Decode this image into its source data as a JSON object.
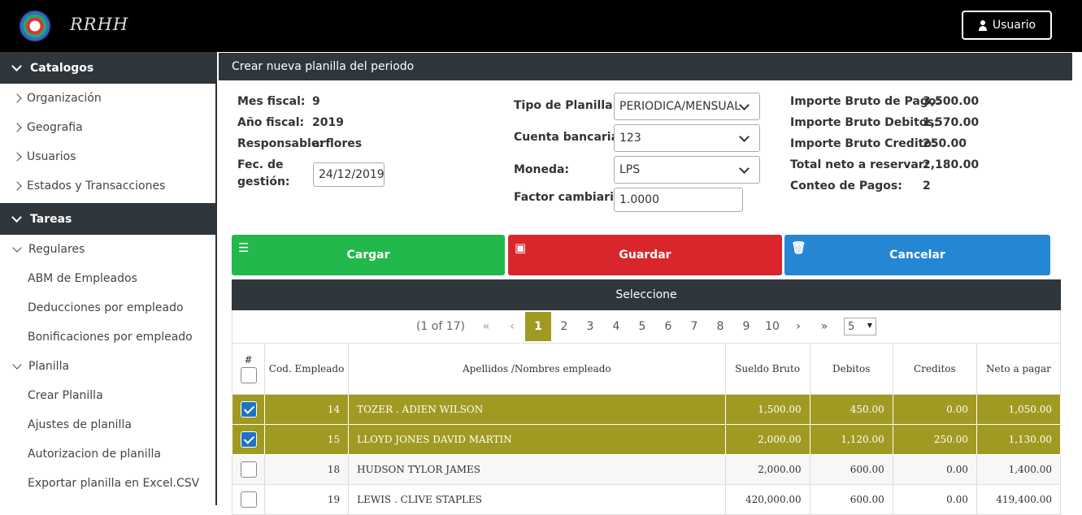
{
  "header": {
    "brand": "RRHH",
    "user_button": "Usuario"
  },
  "sidebar": {
    "catalogos": {
      "title": "Catalogos",
      "items": [
        "Organización",
        "Geografia",
        "Usuarios",
        "Estados y Transacciones"
      ]
    },
    "tareas": {
      "title": "Tareas",
      "groups": [
        {
          "label": "Regulares",
          "items": [
            "ABM de Empleados",
            "Deducciones por empleado",
            "Bonificaciones por empleado"
          ]
        },
        {
          "label": "Planilla",
          "items": [
            "Crear Planilla",
            "Ajustes de planilla",
            "Autorizacion de planilla",
            "Exportar planilla en Excel.CSV"
          ]
        }
      ]
    }
  },
  "panel": {
    "title": "Crear nueva planilla del periodo",
    "left": {
      "mes_fiscal_label": "Mes fiscal:",
      "mes_fiscal": "9",
      "anio_fiscal_label": "Año fiscal:",
      "anio_fiscal": "2019",
      "responsable_label": "Responsable:",
      "responsable": "arflores",
      "fecha_label_1": "Fec. de",
      "fecha_label_2": "gestión:",
      "fecha": "24/12/2019"
    },
    "middle": {
      "tipo_label": "Tipo de Planilla:",
      "tipo": "PERIODICA/MENSUAL",
      "cuenta_label": "Cuenta bancaria:",
      "cuenta": "123",
      "moneda_label": "Moneda:",
      "moneda": "LPS",
      "factor_label": "Factor cambiario:",
      "factor": "1.0000"
    },
    "right": {
      "bruto_pago_label": "Importe Bruto de Pago:",
      "bruto_pago": "3,500.00",
      "bruto_debitos_label": "Importe Bruto Debitos:",
      "bruto_debitos": "1,570.00",
      "bruto_credito_label": "Importe Bruto Credito:",
      "bruto_credito": "250.00",
      "total_neto_label": "Total neto a reservar:",
      "total_neto": "2,180.00",
      "conteo_label": "Conteo de Pagos:",
      "conteo": "2"
    },
    "buttons": {
      "cargar": "Cargar",
      "guardar": "Guardar",
      "cancelar": "Cancelar"
    },
    "colors": {
      "cargar": "#22b84c",
      "guardar": "#d9262c",
      "cancelar": "#2586d4",
      "selected_row": "#a09a22",
      "header_dark": "#2f363c"
    }
  },
  "grid": {
    "title": "Seleccione",
    "pager": {
      "count": "(1 of 17)",
      "pages": [
        "1",
        "2",
        "3",
        "4",
        "5",
        "6",
        "7",
        "8",
        "9",
        "10"
      ],
      "current": "1",
      "rows_per_page": "5"
    },
    "columns": [
      "#",
      "Cod. Empleado",
      "Apellidos /Nombres empleado",
      "Sueldo Bruto",
      "Debitos",
      "Creditos",
      "Neto a pagar"
    ],
    "rows": [
      {
        "selected": true,
        "code": "14",
        "name": "TOZER . ADIEN WILSON",
        "bruto": "1,500.00",
        "debitos": "450.00",
        "creditos": "0.00",
        "neto": "1,050.00"
      },
      {
        "selected": true,
        "code": "15",
        "name": "LLOYD JONES DAVID MARTIN",
        "bruto": "2,000.00",
        "debitos": "1,120.00",
        "creditos": "250.00",
        "neto": "1,130.00"
      },
      {
        "selected": false,
        "code": "18",
        "name": "HUDSON TYLOR JAMES",
        "bruto": "2,000.00",
        "debitos": "600.00",
        "creditos": "0.00",
        "neto": "1,400.00"
      },
      {
        "selected": false,
        "code": "19",
        "name": "LEWIS . CLIVE STAPLES",
        "bruto": "420,000.00",
        "debitos": "600.00",
        "creditos": "0.00",
        "neto": "419,400.00"
      }
    ]
  }
}
